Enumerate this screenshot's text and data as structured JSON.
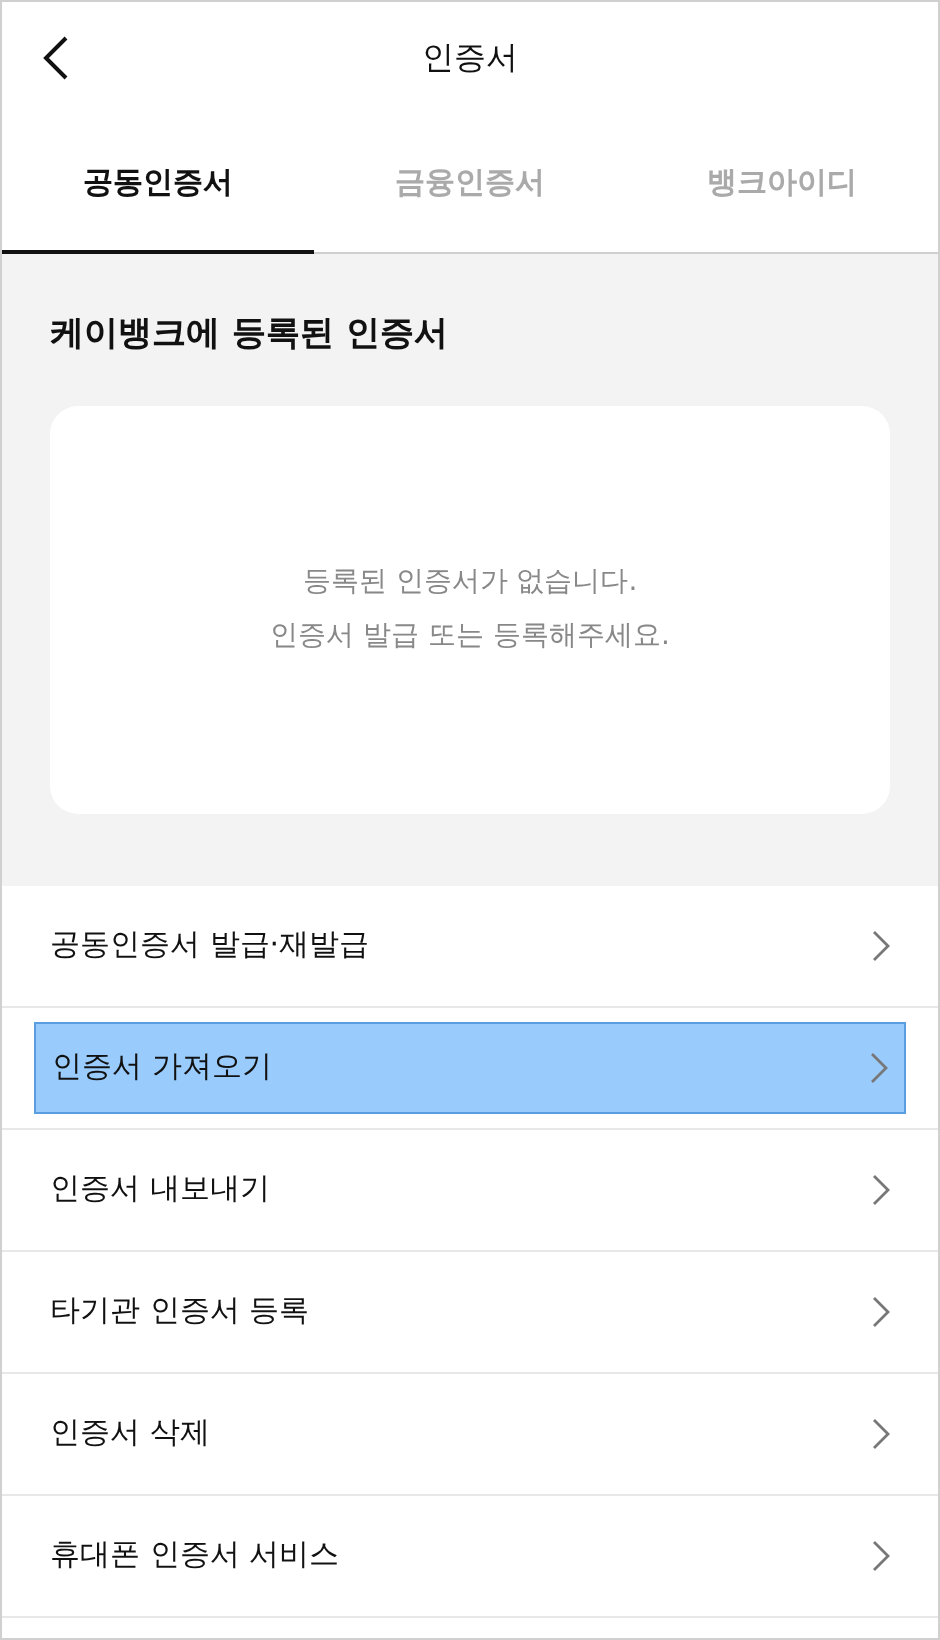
{
  "header": {
    "title": "인증서"
  },
  "tabs": [
    {
      "label": "공동인증서",
      "selected": true
    },
    {
      "label": "금융인증서",
      "selected": false
    },
    {
      "label": "뱅크아이디",
      "selected": false
    }
  ],
  "section": {
    "heading": "케이뱅크에 등록된 인증서",
    "empty_lines": [
      "등록된 인증서가 없습니다.",
      "인증서 발급 또는 등록해주세요."
    ]
  },
  "menu": [
    {
      "label": "공동인증서 발급·재발급",
      "selected": false
    },
    {
      "label": "인증서 가져오기",
      "selected": true
    },
    {
      "label": "인증서 내보내기",
      "selected": false
    },
    {
      "label": "타기관 인증서 등록",
      "selected": false
    },
    {
      "label": "인증서 삭제",
      "selected": false
    },
    {
      "label": "휴대폰 인증서 서비스",
      "selected": false
    }
  ]
}
